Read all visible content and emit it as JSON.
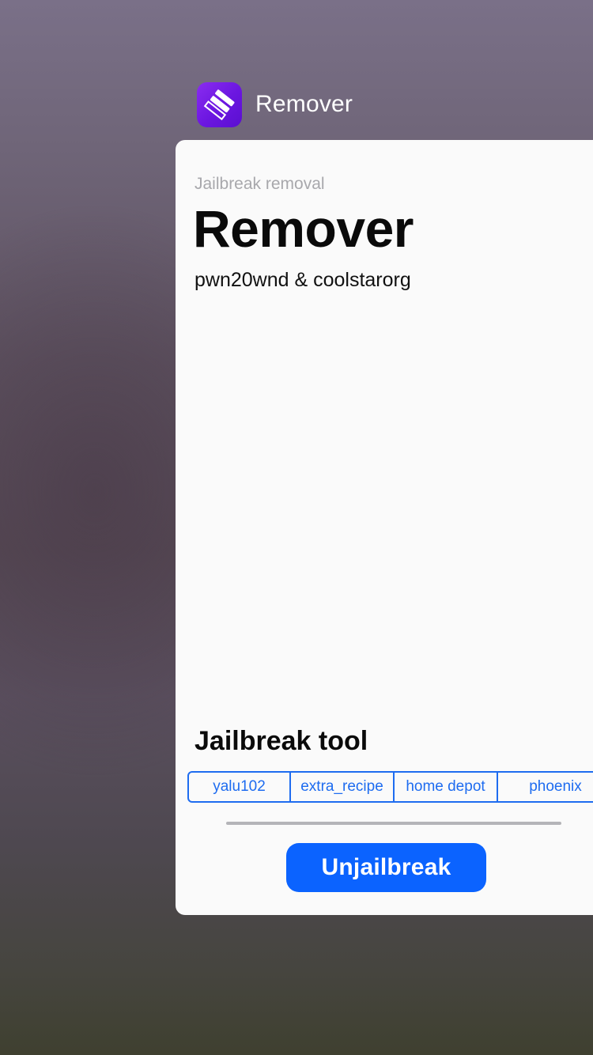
{
  "app_switcher": {
    "app_name": "Remover",
    "app_icon": "remover-app-icon"
  },
  "card": {
    "subtitle": "Jailbreak removal",
    "title": "Remover",
    "authors": "pwn20wnd & coolstarorg",
    "section_title": "Jailbreak tool",
    "tool_options": [
      "yalu102",
      "extra_recipe",
      "home depot",
      "phoenix"
    ],
    "progress": 0,
    "primary_button": "Unjailbreak"
  },
  "colors": {
    "accent": "#1e6cf0",
    "button": "#0b63ff",
    "icon_purple": "#7a1fe8"
  }
}
